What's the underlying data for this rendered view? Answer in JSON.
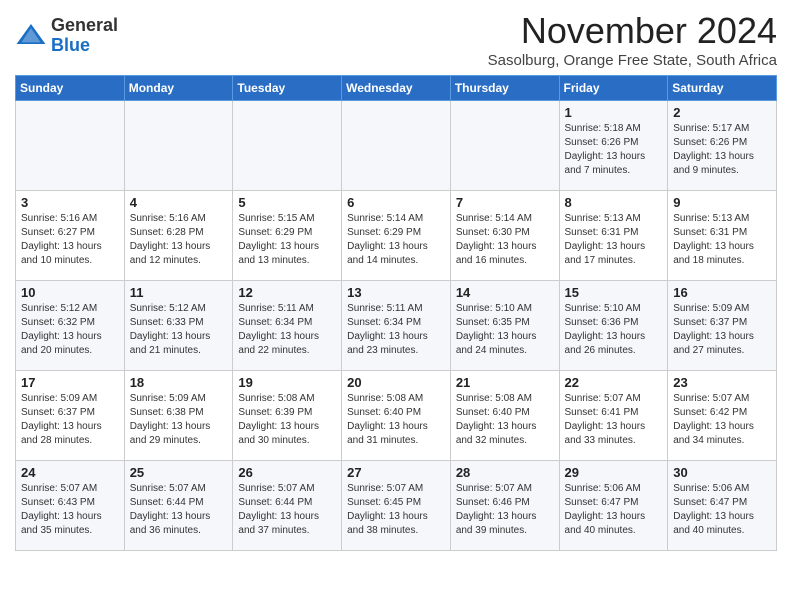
{
  "logo": {
    "general": "General",
    "blue": "Blue"
  },
  "header": {
    "month": "November 2024",
    "location": "Sasolburg, Orange Free State, South Africa"
  },
  "weekdays": [
    "Sunday",
    "Monday",
    "Tuesday",
    "Wednesday",
    "Thursday",
    "Friday",
    "Saturday"
  ],
  "weeks": [
    [
      {
        "day": "",
        "info": ""
      },
      {
        "day": "",
        "info": ""
      },
      {
        "day": "",
        "info": ""
      },
      {
        "day": "",
        "info": ""
      },
      {
        "day": "",
        "info": ""
      },
      {
        "day": "1",
        "info": "Sunrise: 5:18 AM\nSunset: 6:26 PM\nDaylight: 13 hours\nand 7 minutes."
      },
      {
        "day": "2",
        "info": "Sunrise: 5:17 AM\nSunset: 6:26 PM\nDaylight: 13 hours\nand 9 minutes."
      }
    ],
    [
      {
        "day": "3",
        "info": "Sunrise: 5:16 AM\nSunset: 6:27 PM\nDaylight: 13 hours\nand 10 minutes."
      },
      {
        "day": "4",
        "info": "Sunrise: 5:16 AM\nSunset: 6:28 PM\nDaylight: 13 hours\nand 12 minutes."
      },
      {
        "day": "5",
        "info": "Sunrise: 5:15 AM\nSunset: 6:29 PM\nDaylight: 13 hours\nand 13 minutes."
      },
      {
        "day": "6",
        "info": "Sunrise: 5:14 AM\nSunset: 6:29 PM\nDaylight: 13 hours\nand 14 minutes."
      },
      {
        "day": "7",
        "info": "Sunrise: 5:14 AM\nSunset: 6:30 PM\nDaylight: 13 hours\nand 16 minutes."
      },
      {
        "day": "8",
        "info": "Sunrise: 5:13 AM\nSunset: 6:31 PM\nDaylight: 13 hours\nand 17 minutes."
      },
      {
        "day": "9",
        "info": "Sunrise: 5:13 AM\nSunset: 6:31 PM\nDaylight: 13 hours\nand 18 minutes."
      }
    ],
    [
      {
        "day": "10",
        "info": "Sunrise: 5:12 AM\nSunset: 6:32 PM\nDaylight: 13 hours\nand 20 minutes."
      },
      {
        "day": "11",
        "info": "Sunrise: 5:12 AM\nSunset: 6:33 PM\nDaylight: 13 hours\nand 21 minutes."
      },
      {
        "day": "12",
        "info": "Sunrise: 5:11 AM\nSunset: 6:34 PM\nDaylight: 13 hours\nand 22 minutes."
      },
      {
        "day": "13",
        "info": "Sunrise: 5:11 AM\nSunset: 6:34 PM\nDaylight: 13 hours\nand 23 minutes."
      },
      {
        "day": "14",
        "info": "Sunrise: 5:10 AM\nSunset: 6:35 PM\nDaylight: 13 hours\nand 24 minutes."
      },
      {
        "day": "15",
        "info": "Sunrise: 5:10 AM\nSunset: 6:36 PM\nDaylight: 13 hours\nand 26 minutes."
      },
      {
        "day": "16",
        "info": "Sunrise: 5:09 AM\nSunset: 6:37 PM\nDaylight: 13 hours\nand 27 minutes."
      }
    ],
    [
      {
        "day": "17",
        "info": "Sunrise: 5:09 AM\nSunset: 6:37 PM\nDaylight: 13 hours\nand 28 minutes."
      },
      {
        "day": "18",
        "info": "Sunrise: 5:09 AM\nSunset: 6:38 PM\nDaylight: 13 hours\nand 29 minutes."
      },
      {
        "day": "19",
        "info": "Sunrise: 5:08 AM\nSunset: 6:39 PM\nDaylight: 13 hours\nand 30 minutes."
      },
      {
        "day": "20",
        "info": "Sunrise: 5:08 AM\nSunset: 6:40 PM\nDaylight: 13 hours\nand 31 minutes."
      },
      {
        "day": "21",
        "info": "Sunrise: 5:08 AM\nSunset: 6:40 PM\nDaylight: 13 hours\nand 32 minutes."
      },
      {
        "day": "22",
        "info": "Sunrise: 5:07 AM\nSunset: 6:41 PM\nDaylight: 13 hours\nand 33 minutes."
      },
      {
        "day": "23",
        "info": "Sunrise: 5:07 AM\nSunset: 6:42 PM\nDaylight: 13 hours\nand 34 minutes."
      }
    ],
    [
      {
        "day": "24",
        "info": "Sunrise: 5:07 AM\nSunset: 6:43 PM\nDaylight: 13 hours\nand 35 minutes."
      },
      {
        "day": "25",
        "info": "Sunrise: 5:07 AM\nSunset: 6:44 PM\nDaylight: 13 hours\nand 36 minutes."
      },
      {
        "day": "26",
        "info": "Sunrise: 5:07 AM\nSunset: 6:44 PM\nDaylight: 13 hours\nand 37 minutes."
      },
      {
        "day": "27",
        "info": "Sunrise: 5:07 AM\nSunset: 6:45 PM\nDaylight: 13 hours\nand 38 minutes."
      },
      {
        "day": "28",
        "info": "Sunrise: 5:07 AM\nSunset: 6:46 PM\nDaylight: 13 hours\nand 39 minutes."
      },
      {
        "day": "29",
        "info": "Sunrise: 5:06 AM\nSunset: 6:47 PM\nDaylight: 13 hours\nand 40 minutes."
      },
      {
        "day": "30",
        "info": "Sunrise: 5:06 AM\nSunset: 6:47 PM\nDaylight: 13 hours\nand 40 minutes."
      }
    ]
  ]
}
